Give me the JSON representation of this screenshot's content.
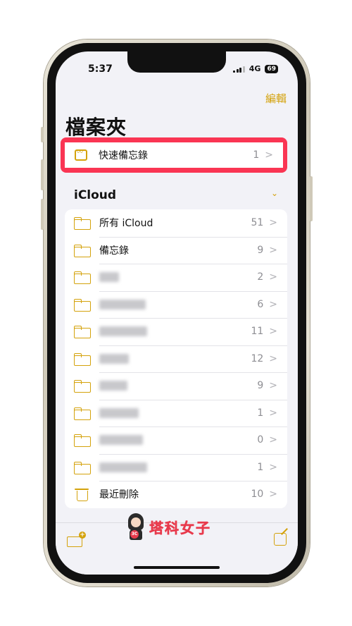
{
  "status": {
    "time": "5:37",
    "network": "4G",
    "battery": "69"
  },
  "header": {
    "edit_label": "編輯",
    "title": "檔案夾"
  },
  "quick_notes": {
    "label": "快速備忘錄",
    "count": "1"
  },
  "section": {
    "title": "iCloud"
  },
  "folders": [
    {
      "label": "所有 iCloud",
      "count": "51"
    },
    {
      "label": "備忘錄",
      "count": "9"
    },
    {
      "label": "",
      "count": "2"
    },
    {
      "label": "",
      "count": "6"
    },
    {
      "label": "",
      "count": "11"
    },
    {
      "label": "",
      "count": "12"
    },
    {
      "label": "",
      "count": "9"
    },
    {
      "label": "",
      "count": "1"
    },
    {
      "label": "",
      "count": "0"
    },
    {
      "label": "",
      "count": "1"
    }
  ],
  "deleted": {
    "label": "最近刪除",
    "count": "10"
  },
  "watermark": {
    "text": "塔科女子",
    "badge": "3C"
  },
  "colors": {
    "accent": "#d4a20b",
    "highlight": "#fa3553",
    "brand": "#e83b4d"
  }
}
